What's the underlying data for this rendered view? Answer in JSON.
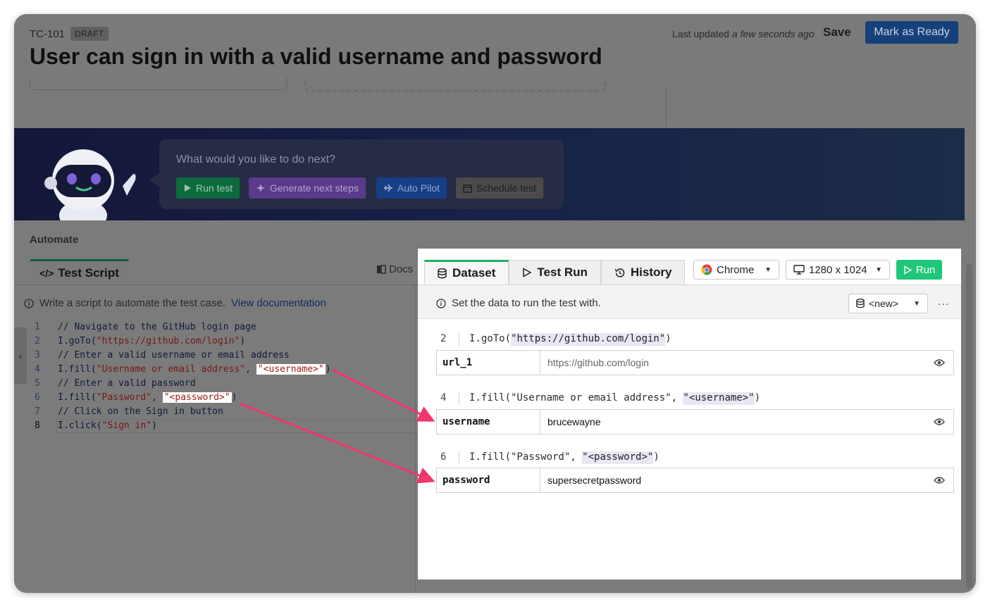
{
  "header": {
    "test_id": "TC-101",
    "status_badge": "DRAFT",
    "title": "User can sign in with a valid username and password",
    "last_updated_label": "Last updated",
    "last_updated_value": "a few seconds ago",
    "save_label": "Save",
    "ready_label": "Mark as Ready"
  },
  "banner": {
    "prompt": "What would you like to do next?",
    "actions": [
      {
        "label": "Run test",
        "icon": "play-icon"
      },
      {
        "label": "Generate next steps",
        "icon": "sparkle-icon"
      },
      {
        "label": "Auto Pilot",
        "icon": "plane-icon"
      },
      {
        "label": "Schedule test",
        "icon": "calendar-icon"
      }
    ]
  },
  "automate": {
    "section_title": "Automate",
    "tab_label": "Test Script",
    "docs_label": "Docs",
    "hint_text": "Write a script to automate the test case.",
    "hint_link": "View documentation",
    "code_lines": [
      {
        "num": "1",
        "text": "// Navigate to the GitHub login page"
      },
      {
        "num": "2",
        "text": "I.goTo(\"https://github.com/login\")"
      },
      {
        "num": "3",
        "text": "// Enter a valid username or email address"
      },
      {
        "num": "4",
        "text": "I.fill(\"Username or email address\", \"<username>\")"
      },
      {
        "num": "5",
        "text": "// Enter a valid password"
      },
      {
        "num": "6",
        "text": "I.fill(\"Password\", \"<password>\")"
      },
      {
        "num": "7",
        "text": "// Click on the Sign in button"
      },
      {
        "num": "8",
        "text": "I.click(\"Sign in\")"
      }
    ]
  },
  "panel": {
    "tabs": [
      "Dataset",
      "Test Run",
      "History"
    ],
    "browser": "Chrome",
    "resolution": "1280 x 1024",
    "run_label": "Run",
    "hint": "Set the data to run the test with.",
    "dataset": "<new>",
    "more": "...",
    "rows": [
      {
        "line_num": "2",
        "line_pre": "I.goTo(",
        "line_var": "\"https://github.com/login\"",
        "line_post": ")",
        "key": "url_1",
        "value": "https://github.com/login",
        "placeholder": true
      },
      {
        "line_num": "4",
        "line_pre": "I.fill(\"Username or email address\", ",
        "line_var": "\"<username>\"",
        "line_post": ")",
        "key": "username",
        "value": "brucewayne",
        "placeholder": false
      },
      {
        "line_num": "6",
        "line_pre": "I.fill(\"Password\", ",
        "line_var": "\"<password>\"",
        "line_post": ")",
        "key": "password",
        "value": "supersecretpassword",
        "placeholder": false
      }
    ]
  },
  "colors": {
    "accent_green": "#1fc77a",
    "annotation_arrow": "#f2356b",
    "ready_blue": "#15407a"
  }
}
